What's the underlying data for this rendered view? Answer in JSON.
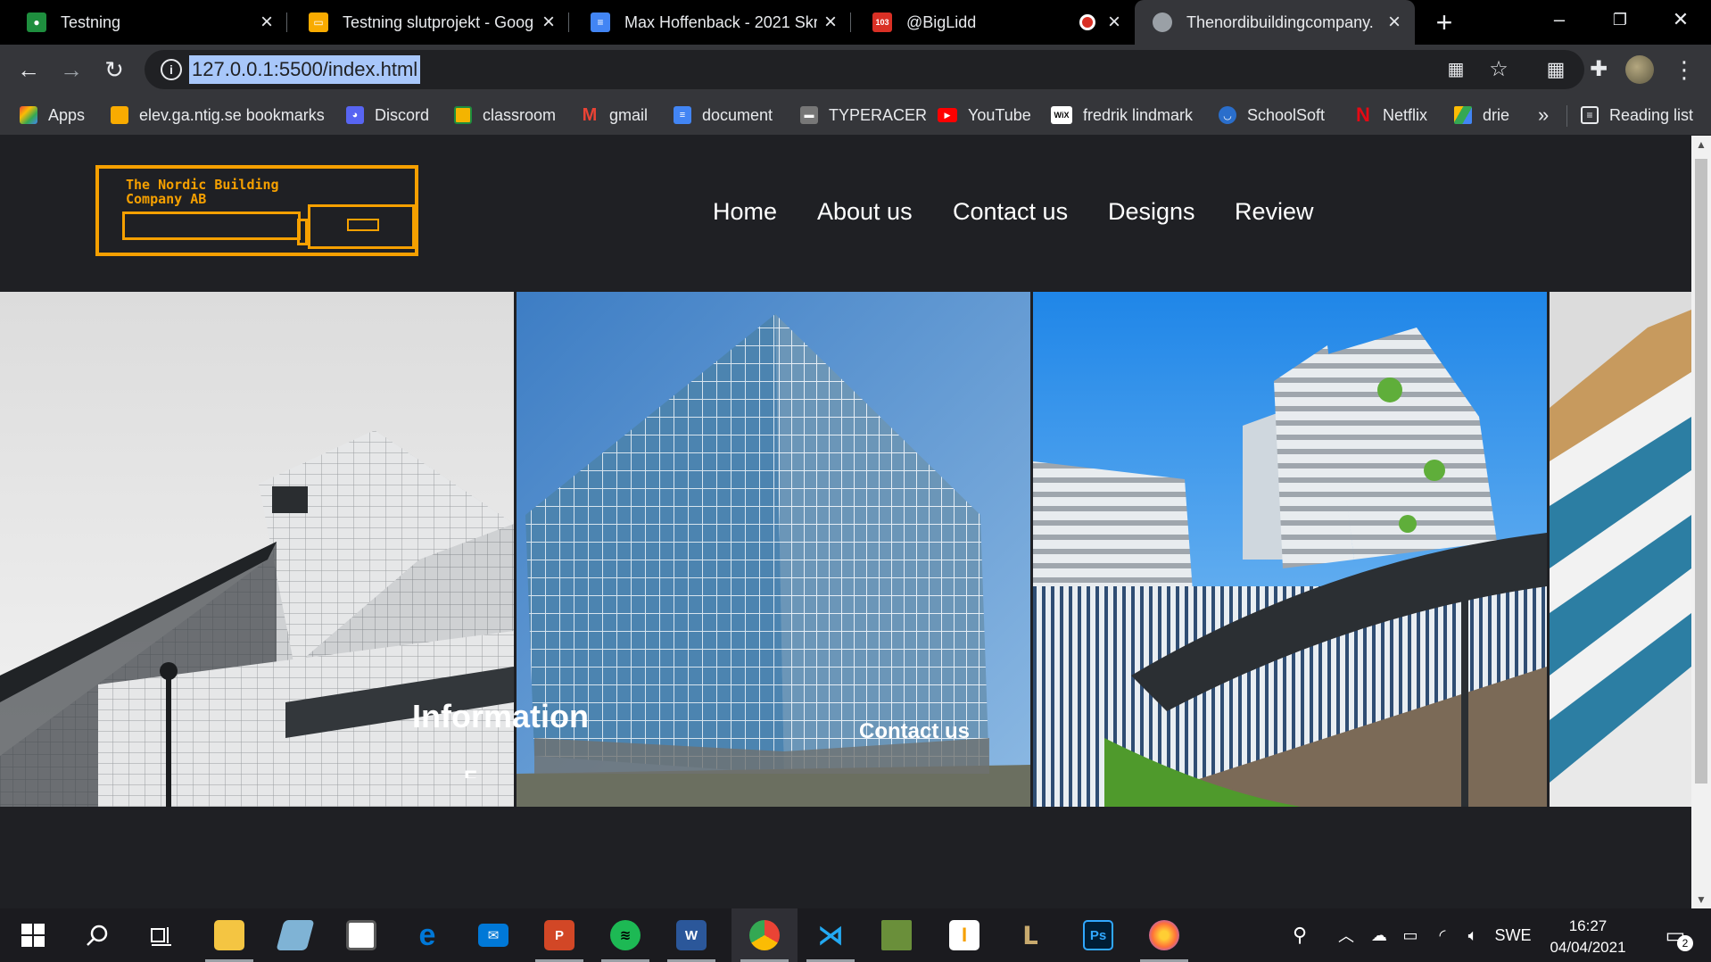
{
  "browser": {
    "tabs": [
      {
        "title": "Testning",
        "icon": "classroom-icon",
        "color": "#1e8e3e"
      },
      {
        "title": "Testning slutprojekt - Goog",
        "icon": "slides-icon",
        "color": "#f9ab00"
      },
      {
        "title": "Max Hoffenback - 2021 Skri",
        "icon": "docs-icon",
        "color": "#4285f4"
      },
      {
        "title": "@BigLidd",
        "icon": "calendar-icon",
        "color": "#d93025",
        "badge": "103"
      },
      {
        "title": "Thenordibuildingcompany.",
        "icon": "globe-icon",
        "color": "#9aa0a6"
      }
    ],
    "new_tab_label": "+",
    "window_controls": {
      "minimize": "–",
      "restore": "❐",
      "close": "✕"
    },
    "url": "127.0.0.1:5500/index.html",
    "bookmarks": [
      {
        "label": "Apps",
        "icon": "apps-grid-icon",
        "color": "#ea4335"
      },
      {
        "label": "elev.ga.ntig.se bookmarks",
        "icon": "folder-icon",
        "color": "#f9ab00"
      },
      {
        "label": "Discord",
        "icon": "discord-icon",
        "color": "#5865f2"
      },
      {
        "label": "classroom",
        "icon": "classroom-icon",
        "color": "#1e8e3e"
      },
      {
        "label": "gmail",
        "icon": "gmail-icon",
        "color": "#ea4335"
      },
      {
        "label": "document",
        "icon": "docs-icon",
        "color": "#4285f4"
      },
      {
        "label": "TYPERACER",
        "icon": "typeracer-icon",
        "color": "#777777"
      },
      {
        "label": "YouTube",
        "icon": "youtube-icon",
        "color": "#ff0000"
      },
      {
        "label": "fredrik lindmark",
        "icon": "wix-icon",
        "color": "#ffffff"
      },
      {
        "label": "SchoolSoft",
        "icon": "schoolsoft-icon",
        "color": "#2a6ecb"
      },
      {
        "label": "Netflix",
        "icon": "netflix-icon",
        "color": "#e50914"
      },
      {
        "label": "drie",
        "icon": "drive-icon",
        "color": "#34a853"
      }
    ],
    "overflow_label": "»",
    "reading_list_label": "Reading list"
  },
  "site": {
    "logo_text": "The Nordic Building\nCompany AB",
    "nav": [
      "Home",
      "About us",
      "Contact us",
      "Designs",
      "Review"
    ],
    "accent_color": "#f6a000",
    "background_color": "#1f2024",
    "gallery": [
      {
        "name": "photo-white-angular-building"
      },
      {
        "name": "photo-glass-office-tower"
      },
      {
        "name": "photo-green-terraced-towers"
      },
      {
        "name": "photo-striped-facade"
      }
    ],
    "info_heading": "Information",
    "contact_heading": "Contact us",
    "info_partial_text": "F"
  },
  "taskbar": {
    "apps": [
      {
        "name": "start-icon"
      },
      {
        "name": "search-icon"
      },
      {
        "name": "task-view-icon"
      },
      {
        "name": "file-explorer-icon",
        "color": "#f4c542"
      },
      {
        "name": "notes-icon",
        "color": "#7fb3d5"
      },
      {
        "name": "store-icon",
        "color": "#5a5a5a"
      },
      {
        "name": "edge-icon",
        "color": "#0078d7"
      },
      {
        "name": "mail-icon",
        "color": "#0078d7"
      },
      {
        "name": "powerpoint-icon",
        "color": "#d24726",
        "label": "P"
      },
      {
        "name": "spotify-icon",
        "color": "#1db954"
      },
      {
        "name": "word-icon",
        "color": "#2b579a",
        "label": "W"
      },
      {
        "name": "chrome-icon",
        "color": "#4285f4"
      },
      {
        "name": "vscode-icon",
        "color": "#23a9f2"
      },
      {
        "name": "minecraft-icon",
        "color": "#6a8f3a"
      },
      {
        "name": "instrument-icon",
        "color": "#f6a000",
        "label": "I"
      },
      {
        "name": "league-icon",
        "color": "#c8aa6e"
      },
      {
        "name": "photoshop-icon",
        "color": "#31a8ff",
        "label": "Ps"
      },
      {
        "name": "firefox-icon",
        "color": "#ff7139"
      }
    ],
    "language": "SWE",
    "time": "16:27",
    "date": "04/04/2021",
    "notification_count": "2"
  }
}
